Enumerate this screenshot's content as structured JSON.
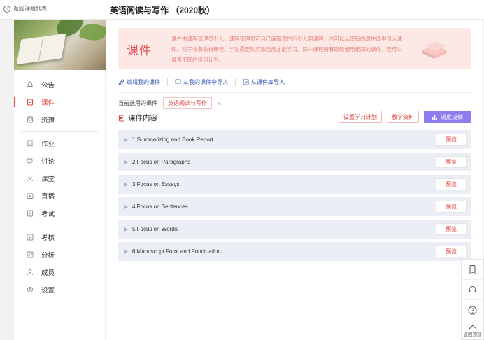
{
  "topbar": {
    "back_label": "返回课程列表",
    "course_title": "英语阅读与写作 （2020秋）"
  },
  "sidebar": {
    "groups": [
      [
        {
          "label": "公告",
          "icon": "bell-icon"
        },
        {
          "label": "课件",
          "icon": "courseware-icon",
          "active": true
        },
        {
          "label": "资源",
          "icon": "resource-icon"
        }
      ],
      [
        {
          "label": "作业",
          "icon": "homework-icon"
        },
        {
          "label": "讨论",
          "icon": "discussion-icon"
        },
        {
          "label": "课堂",
          "icon": "classroom-icon"
        },
        {
          "label": "直播",
          "icon": "live-icon"
        },
        {
          "label": "考试",
          "icon": "exam-icon"
        }
      ],
      [
        {
          "label": "考核",
          "icon": "assessment-icon"
        },
        {
          "label": "分析",
          "icon": "analysis-icon"
        },
        {
          "label": "成员",
          "icon": "members-icon"
        },
        {
          "label": "设置",
          "icon": "settings-icon"
        }
      ]
    ]
  },
  "banner": {
    "title": "课件",
    "text": "课件由课程管理员引入，课程管理员可自己编辑课件后引入到课程，也可以从现有的课件库中引入课件。对于收费教材课程，学生需要购买激活后才能学习。同一课程所有班级使用相同的课件，但可以设置不同的学习计划。"
  },
  "actions": {
    "edit_label": "编辑我的课件",
    "import_mine_label": "从我的课件中导入",
    "import_library_label": "从课件库导入"
  },
  "current": {
    "label": "当前选用的课件",
    "tag": "英语阅读与写作",
    "close": "×"
  },
  "content": {
    "title": "课件内容",
    "buttons": {
      "plan": "设置学习计划",
      "materials": "教学资料",
      "progress": "进度成绩"
    },
    "preview_label": "预览",
    "chapters": [
      "1 Summarizing and Book Report",
      "2 Focus on Paragraphs",
      "3 Focus on Essays",
      "4 Focus on Sentences",
      "5 Focus on Words",
      "6 Manuscript Form and Punctuation"
    ]
  },
  "floatbar": {
    "back_top_label": "返回顶部"
  },
  "colors": {
    "accent": "#e5403c",
    "link": "#3a5db8",
    "primary_button": "#8e7bf0",
    "banner_bg": "#fce9e6",
    "chapter_bg": "#eceef6"
  }
}
